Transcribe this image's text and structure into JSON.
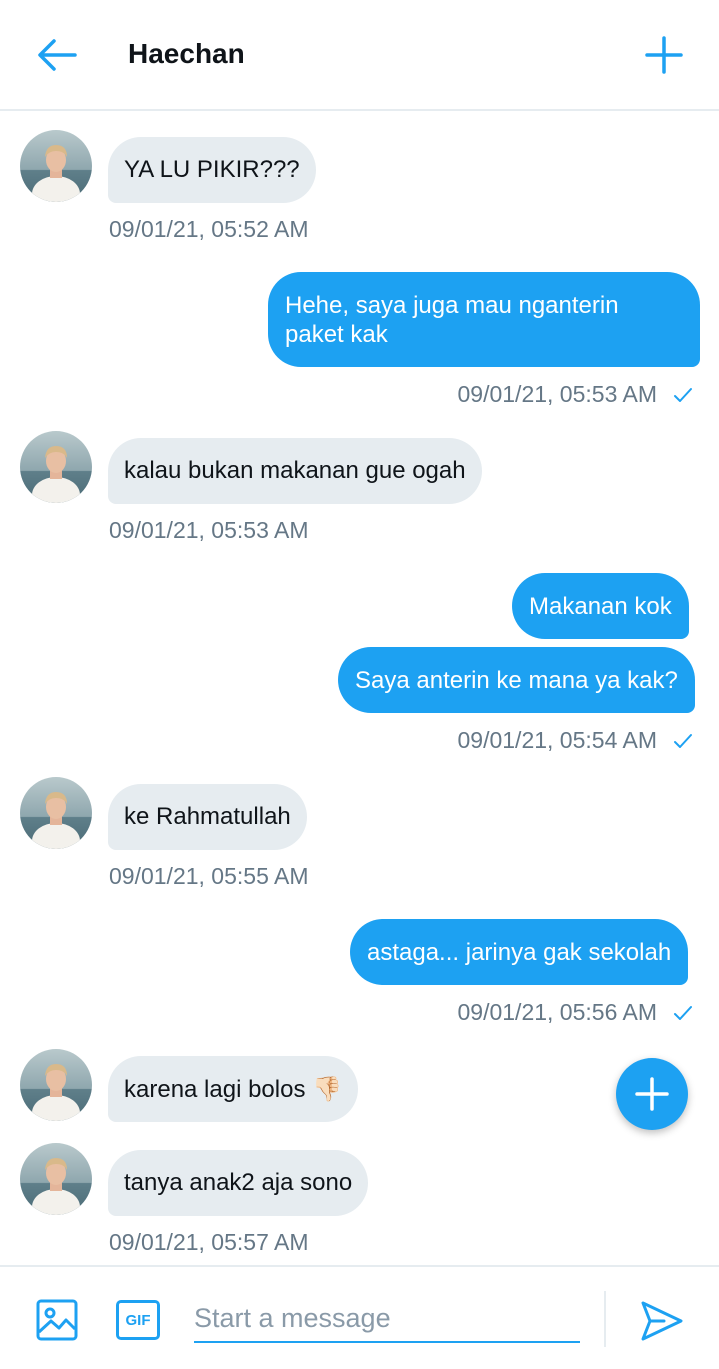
{
  "header": {
    "title": "Haechan"
  },
  "messages": {
    "m1": {
      "text": "YA LU PIKIR???",
      "time": "09/01/21, 05:52 AM"
    },
    "m2": {
      "text": "Hehe, saya juga mau nganterin paket kak",
      "time": "09/01/21, 05:53 AM"
    },
    "m3": {
      "text": "kalau bukan makanan gue ogah",
      "time": "09/01/21, 05:53 AM"
    },
    "m4a": {
      "text": "Makanan kok"
    },
    "m4b": {
      "text": "Saya anterin ke mana ya kak?",
      "time": "09/01/21, 05:54 AM"
    },
    "m5": {
      "text": "ke Rahmatullah",
      "time": "09/01/21, 05:55 AM"
    },
    "m6": {
      "text": "astaga... jarinya gak sekolah",
      "time": "09/01/21, 05:56 AM"
    },
    "m7": {
      "text": "karena lagi bolos 👎🏻"
    },
    "m8": {
      "text": "tanya anak2 aja sono",
      "time": "09/01/21, 05:57 AM"
    }
  },
  "composer": {
    "gif_label": "GIF",
    "placeholder": "Start a message"
  },
  "colors": {
    "accent": "#1da1f2",
    "incoming_bubble": "#e6ecf0",
    "timestamp": "#657786"
  },
  "icons": [
    "back-arrow-icon",
    "plus-icon",
    "check-icon",
    "image-icon",
    "gif-icon",
    "send-icon",
    "avatar"
  ]
}
